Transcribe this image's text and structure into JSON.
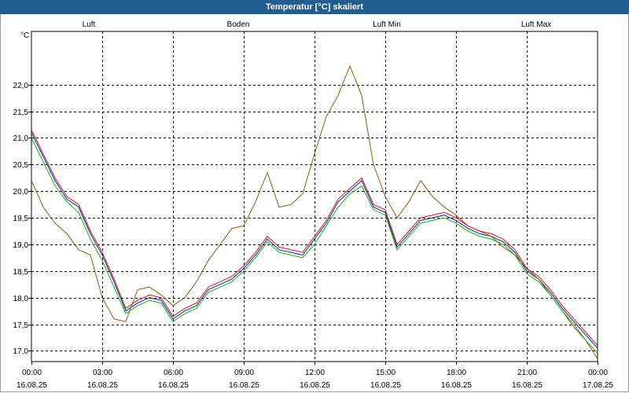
{
  "window": {
    "title": "Temperatur [°C] skaliert"
  },
  "chart_data": {
    "type": "line",
    "title": "Temperatur [°C] skaliert",
    "ylabel": "°C",
    "xlabel": "",
    "ylim": [
      16.8,
      23.0
    ],
    "yticks": [
      17.0,
      17.5,
      18.0,
      18.5,
      19.0,
      19.5,
      20.0,
      20.5,
      21.0,
      21.5,
      22.0
    ],
    "ytick_labels": [
      "17,0",
      "17,5",
      "18,0",
      "18,5",
      "19,0",
      "19,5",
      "20,0",
      "20,5",
      "21,0",
      "21,5",
      "22,0"
    ],
    "x_range_hours": [
      0,
      24
    ],
    "x_ticks_hours": [
      0,
      3,
      6,
      9,
      12,
      15,
      18,
      21,
      24
    ],
    "x_tick_labels": [
      {
        "time": "00:00",
        "date": "16.08.25"
      },
      {
        "time": "03:00",
        "date": "16.08.25"
      },
      {
        "time": "06:00",
        "date": "16.08.25"
      },
      {
        "time": "09:00",
        "date": "16.08.25"
      },
      {
        "time": "12:00",
        "date": "16.08.25"
      },
      {
        "time": "15:00",
        "date": "16.08.25"
      },
      {
        "time": "18:00",
        "date": "16.08.25"
      },
      {
        "time": "21:00",
        "date": "16.08.25"
      },
      {
        "time": "00:00",
        "date": "17.08.25"
      }
    ],
    "grid": true,
    "legend_position": "top",
    "series": [
      {
        "name": "Luft",
        "color": "#1a1ab0",
        "x": [
          0,
          1,
          1.5,
          2,
          2.5,
          3,
          3.5,
          4,
          4.5,
          5,
          5.5,
          6,
          6.5,
          7,
          7.5,
          8,
          8.5,
          9,
          9.5,
          10,
          10.5,
          11,
          11.5,
          12,
          12.5,
          13,
          13.5,
          14,
          14.5,
          15,
          15.5,
          16,
          16.5,
          17,
          17.5,
          18,
          18.5,
          19,
          19.5,
          20,
          20.5,
          21,
          21.5,
          22,
          22.5,
          23,
          23.5,
          24
        ],
        "values": [
          21.1,
          20.2,
          19.85,
          19.7,
          19.2,
          18.8,
          18.3,
          17.75,
          17.9,
          18.0,
          17.95,
          17.6,
          17.75,
          17.85,
          18.15,
          18.25,
          18.35,
          18.55,
          18.8,
          19.1,
          18.9,
          18.85,
          18.8,
          19.1,
          19.4,
          19.8,
          20.0,
          20.2,
          19.7,
          19.6,
          18.95,
          19.2,
          19.45,
          19.5,
          19.55,
          19.45,
          19.3,
          19.2,
          19.15,
          19.05,
          18.85,
          18.5,
          18.35,
          18.1,
          17.8,
          17.55,
          17.3,
          17.05
        ]
      },
      {
        "name": "Boden",
        "color": "#8b5a10",
        "x": [
          0,
          0.5,
          1,
          1.5,
          2,
          2.5,
          3,
          3.5,
          4,
          4.5,
          5,
          5.5,
          6,
          6.5,
          7,
          7.5,
          8,
          8.5,
          9,
          9.5,
          10,
          10.5,
          11,
          11.5,
          12,
          12.5,
          13,
          13.5,
          14,
          14.5,
          15,
          15.5,
          16,
          16.5,
          17,
          17.5,
          18,
          18.5,
          19,
          19.5,
          20,
          20.5,
          21,
          21.5,
          22,
          22.5,
          23,
          23.5,
          24
        ],
        "values": [
          20.2,
          19.7,
          19.4,
          19.2,
          18.9,
          18.8,
          18.0,
          17.6,
          17.55,
          18.15,
          18.2,
          18.05,
          17.85,
          18.0,
          18.3,
          18.7,
          19.0,
          19.3,
          19.35,
          19.8,
          20.35,
          19.7,
          19.75,
          19.95,
          20.7,
          21.4,
          21.8,
          22.35,
          21.8,
          20.5,
          19.9,
          19.5,
          19.8,
          20.2,
          19.9,
          19.7,
          19.55,
          19.35,
          19.25,
          19.15,
          18.95,
          18.8,
          18.55,
          18.35,
          18.05,
          17.75,
          17.45,
          17.2,
          16.85
        ]
      },
      {
        "name": "Luft Min",
        "color": "#11b011",
        "x": [
          0,
          1,
          1.5,
          2,
          2.5,
          3,
          3.5,
          4,
          4.5,
          5,
          5.5,
          6,
          6.5,
          7,
          7.5,
          8,
          8.5,
          9,
          9.5,
          10,
          10.5,
          11,
          11.5,
          12,
          12.5,
          13,
          13.5,
          14,
          14.5,
          15,
          15.5,
          16,
          16.5,
          17,
          17.5,
          18,
          18.5,
          19,
          19.5,
          20,
          20.5,
          21,
          21.5,
          22,
          22.5,
          23,
          23.5,
          24
        ],
        "values": [
          21.0,
          20.1,
          19.8,
          19.6,
          19.1,
          18.7,
          18.2,
          17.7,
          17.85,
          17.95,
          17.9,
          17.55,
          17.7,
          17.8,
          18.1,
          18.2,
          18.3,
          18.5,
          18.75,
          19.05,
          18.85,
          18.8,
          18.75,
          19.0,
          19.35,
          19.7,
          19.95,
          20.1,
          19.65,
          19.55,
          18.9,
          19.15,
          19.4,
          19.45,
          19.5,
          19.4,
          19.25,
          19.15,
          19.1,
          19.0,
          18.8,
          18.45,
          18.3,
          18.05,
          17.75,
          17.5,
          17.2,
          16.95
        ]
      },
      {
        "name": "Luft Max",
        "color": "#c81a1a",
        "x": [
          0,
          1,
          1.5,
          2,
          2.5,
          3,
          3.5,
          4,
          4.5,
          5,
          5.5,
          6,
          6.5,
          7,
          7.5,
          8,
          8.5,
          9,
          9.5,
          10,
          10.5,
          11,
          11.5,
          12,
          12.5,
          13,
          13.5,
          14,
          14.5,
          15,
          15.5,
          16,
          16.5,
          17,
          17.5,
          18,
          18.5,
          19,
          19.5,
          20,
          20.5,
          21,
          21.5,
          22,
          22.5,
          23,
          23.5,
          24
        ],
        "values": [
          21.15,
          20.25,
          19.9,
          19.75,
          19.25,
          18.85,
          18.35,
          17.8,
          17.95,
          18.05,
          18.0,
          17.65,
          17.8,
          17.9,
          18.2,
          18.3,
          18.4,
          18.6,
          18.85,
          19.15,
          18.95,
          18.9,
          18.85,
          19.15,
          19.45,
          19.85,
          20.05,
          20.25,
          19.75,
          19.65,
          19.0,
          19.25,
          19.5,
          19.55,
          19.6,
          19.5,
          19.35,
          19.25,
          19.2,
          19.1,
          18.9,
          18.55,
          18.4,
          18.15,
          17.85,
          17.6,
          17.35,
          17.1
        ]
      }
    ]
  }
}
